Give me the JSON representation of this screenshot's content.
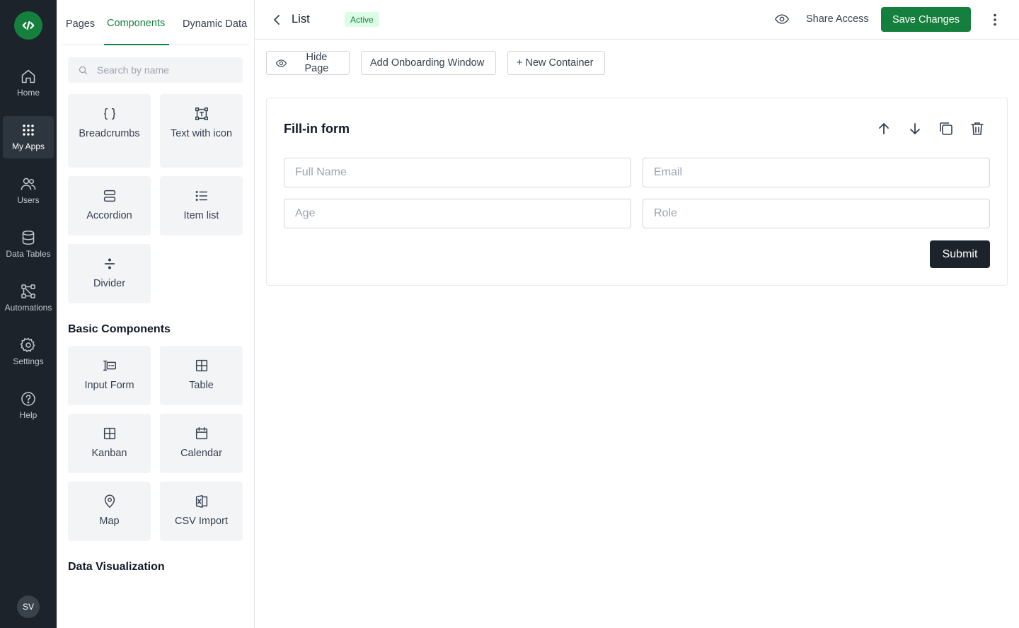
{
  "rail": {
    "items": [
      {
        "label": "Home",
        "icon": "home-icon"
      },
      {
        "label": "My Apps",
        "icon": "grid-dots-icon",
        "active": true
      },
      {
        "label": "Users",
        "icon": "users-icon"
      },
      {
        "label": "Data Tables",
        "icon": "database-icon"
      },
      {
        "label": "Automations",
        "icon": "workflow-icon"
      },
      {
        "label": "Settings",
        "icon": "gear-icon"
      },
      {
        "label": "Help",
        "icon": "help-circle-icon"
      }
    ],
    "avatar": "SV"
  },
  "panel": {
    "tabs": [
      "Pages",
      "Components",
      "Dynamic Data"
    ],
    "active_tab": "Components",
    "search_placeholder": "Search by name",
    "components": [
      {
        "label": "Breadcrumbs",
        "icon": "braces-icon"
      },
      {
        "label": "Text with icon",
        "icon": "text-frame-icon"
      },
      {
        "label": "Accordion",
        "icon": "accordion-icon"
      },
      {
        "label": "Item list",
        "icon": "list-icon"
      },
      {
        "label": "Divider",
        "icon": "divide-icon"
      }
    ],
    "basic_title": "Basic Components",
    "basic": [
      {
        "label": "Input Form",
        "icon": "input-form-icon"
      },
      {
        "label": "Table",
        "icon": "table-icon"
      },
      {
        "label": "Kanban",
        "icon": "kanban-icon"
      },
      {
        "label": "Calendar",
        "icon": "calendar-icon"
      },
      {
        "label": "Map",
        "icon": "map-pin-icon"
      },
      {
        "label": "CSV Import",
        "icon": "csv-file-icon"
      }
    ],
    "dataviz_title": "Data Visualization"
  },
  "header": {
    "title": "List",
    "status": "Active",
    "share_label": "Share Access",
    "save_label": "Save Changes"
  },
  "toolbar": {
    "hide_page": "Hide Page",
    "onboarding": "Add Onboarding Window",
    "new_container": "+ New Container"
  },
  "form": {
    "title": "Fill-in form",
    "fields": [
      {
        "placeholder": "Full Name"
      },
      {
        "placeholder": "Email"
      },
      {
        "placeholder": "Age"
      },
      {
        "placeholder": "Role"
      }
    ],
    "submit_label": "Submit"
  },
  "colors": {
    "accent": "#15803d",
    "rail_bg": "#1c232b",
    "status_bg": "#dcfce7"
  }
}
